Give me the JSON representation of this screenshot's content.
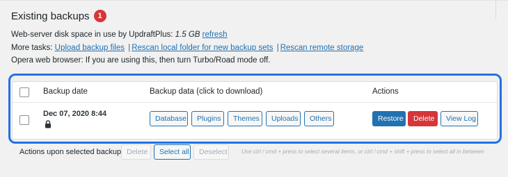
{
  "page": {
    "title": "Existing backups",
    "count_badge": "1"
  },
  "disk_line": {
    "label": "Web-server disk space in use by UpdraftPlus:",
    "value": "1.5 GB",
    "link": "refresh"
  },
  "tasks_line": {
    "label": "More tasks:",
    "links": [
      "Upload backup files",
      "Rescan local folder for new backup sets",
      "Rescan remote storage"
    ],
    "separator": "|"
  },
  "opera_line": {
    "label": "Opera web browser:",
    "text": "If you are using this, then turn Turbo/Road mode off."
  },
  "table": {
    "headers": {
      "date": "Backup date",
      "data": "Backup data (click to download)",
      "actions": "Actions"
    },
    "rows": [
      {
        "date": "Dec 07, 2020 8:44",
        "lock_icon": "lock-icon",
        "data_buttons": [
          "Database",
          "Plugins",
          "Themes",
          "Uploads",
          "Others"
        ],
        "actions": {
          "restore": "Restore",
          "delete": "Delete",
          "view_log": "View Log"
        }
      }
    ]
  },
  "bulk": {
    "label": "Actions upon selected backups",
    "delete": "Delete",
    "select_all": "Select all",
    "deselect": "Deselect",
    "hint": "Use ctrl / cmd + press to select several items, or ctrl / cmd + shift + press to select all in between"
  },
  "colors": {
    "accent": "#2271b1",
    "focus_ring": "#2271e6",
    "danger": "#d63638",
    "background": "#f1f1f1"
  }
}
